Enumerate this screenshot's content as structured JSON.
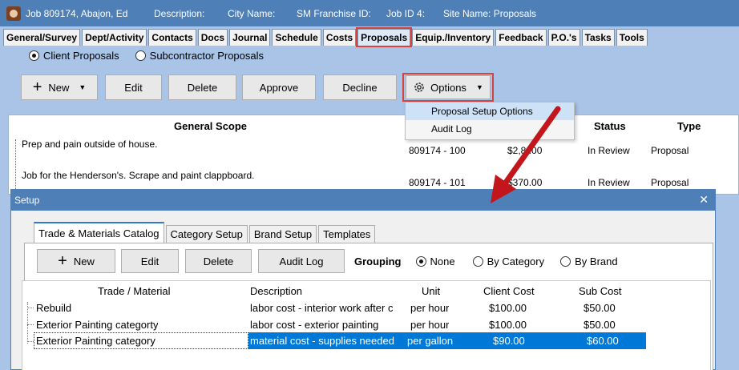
{
  "titlebar": {
    "job": "Job 809174, Abajon, Ed",
    "description": "Description:",
    "city": "City Name:",
    "franchise": "SM Franchise ID:",
    "jobid": "Job ID 4:",
    "site": "Site Name: Proposals"
  },
  "tabs": [
    "General/Survey",
    "Dept/Activity",
    "Contacts",
    "Docs",
    "Journal",
    "Schedule",
    "Costs",
    "Proposals",
    "Equip./Inventory",
    "Feedback",
    "P.O.'s",
    "Tasks",
    "Tools"
  ],
  "active_tab": "Proposals",
  "radios": {
    "client": "Client Proposals",
    "subcontractor": "Subcontractor Proposals",
    "selected": "client"
  },
  "toolbar": {
    "new": "New",
    "edit": "Edit",
    "delete": "Delete",
    "approve": "Approve",
    "decline": "Decline",
    "options": "Options"
  },
  "options_menu": [
    "Proposal Setup Options",
    "Audit Log"
  ],
  "proposals_grid": {
    "headers": {
      "scope": "General Scope",
      "status": "Status",
      "type": "Type"
    },
    "rows": [
      {
        "scope": "Prep and pain outside of house.",
        "id": "809174 - 100",
        "amount": "$2,8 .00",
        "status": "In Review",
        "type": "Proposal"
      },
      {
        "scope": "Job for the Henderson's. Scrape and paint clappboard.",
        "id": "809174 - 101",
        "amount": "$370.00",
        "status": "In Review",
        "type": "Proposal"
      }
    ]
  },
  "dialog": {
    "title": "Setup",
    "close": "✕",
    "tabs": [
      "Trade & Materials Catalog",
      "Category Setup",
      "Brand Setup",
      "Templates"
    ],
    "active_tab": "Trade & Materials Catalog",
    "buttons": {
      "new": "New",
      "edit": "Edit",
      "delete": "Delete",
      "audit": "Audit Log"
    },
    "grouping": {
      "label": "Grouping",
      "options": [
        "None",
        "By Category",
        "By Brand"
      ],
      "selected": "None"
    },
    "table": {
      "headers": [
        "Trade / Material",
        "Description",
        "Unit",
        "Client Cost",
        "Sub Cost"
      ],
      "rows": [
        {
          "name": "Rebuild",
          "description": "labor cost - interior work after c",
          "unit": "per hour",
          "client": "$100.00",
          "sub": "$50.00"
        },
        {
          "name": "Exterior Painting categorty",
          "description": "labor cost - exterior painting",
          "unit": "per hour",
          "client": "$100.00",
          "sub": "$50.00"
        },
        {
          "name": "Exterior Painting category",
          "description": "material cost - supplies needed",
          "unit": "per gallon",
          "client": "$90.00",
          "sub": "$60.00"
        }
      ]
    }
  },
  "colors": {
    "highlight_red": "#d9423b",
    "title_blue": "#4f7fb7",
    "selection_blue": "#0078d7",
    "arrow_red": "#c3161c"
  }
}
